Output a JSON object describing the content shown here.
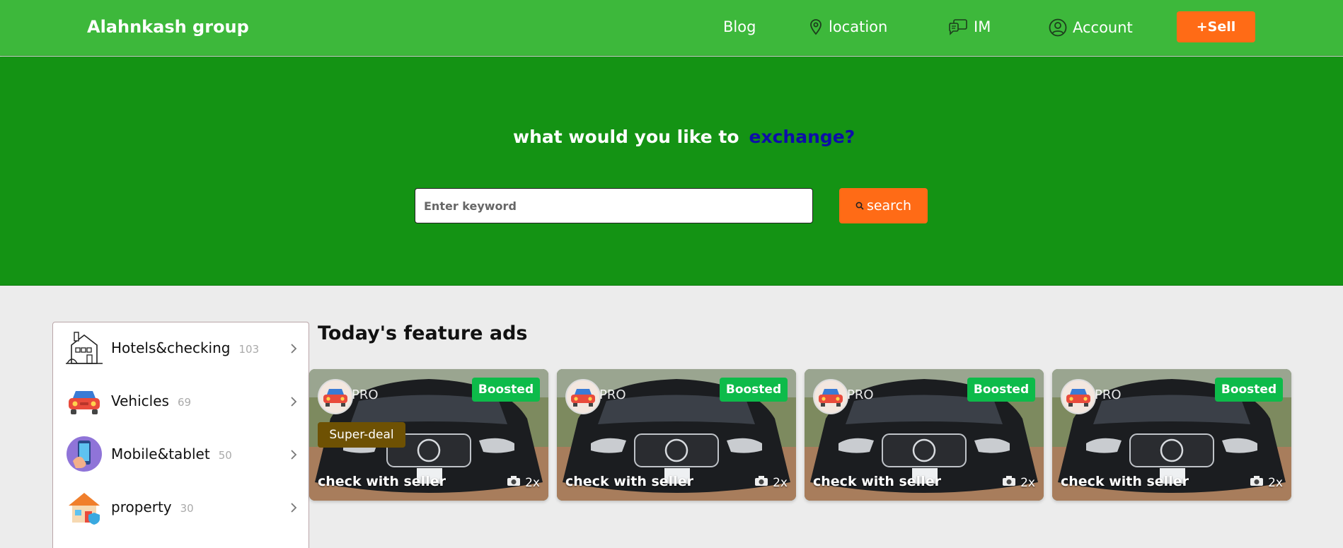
{
  "header": {
    "brand": "Alahnkash group",
    "nav": {
      "blog": "Blog",
      "location": "location",
      "im": "IM",
      "account": "Account"
    },
    "sell_label": "+Sell"
  },
  "hero": {
    "title_lead": "what would you like to",
    "title_accent": "exchange?",
    "search_placeholder": "Enter keyword",
    "search_value": "",
    "search_button": "search"
  },
  "categories": [
    {
      "name": "Hotels&checking",
      "count": "103",
      "icon": "hotel-icon"
    },
    {
      "name": "Vehicles",
      "count": "69",
      "icon": "car-icon"
    },
    {
      "name": "Mobile&tablet",
      "count": "50",
      "icon": "mobile-icon"
    },
    {
      "name": "property",
      "count": "30",
      "icon": "house-icon"
    }
  ],
  "feature_ads": {
    "title": "Today's feature ads",
    "ads": [
      {
        "badge": "Boosted",
        "tier": "PRO",
        "deal": "Super-deal",
        "title": "check with seller",
        "photos": "2x"
      },
      {
        "badge": "Boosted",
        "tier": "PRO",
        "deal": "",
        "title": "check with seller",
        "photos": "2x"
      },
      {
        "badge": "Boosted",
        "tier": "PRO",
        "deal": "",
        "title": "check with seller",
        "photos": "2x"
      },
      {
        "badge": "Boosted",
        "tier": "PRO",
        "deal": "",
        "title": "check with seller",
        "photos": "2x"
      }
    ]
  },
  "colors": {
    "topbar": "#3db83b",
    "hero": "#149314",
    "accent_orange": "#ff6b16",
    "accent_blue": "#0d0ea8",
    "boosted_green": "#0dbb4a"
  }
}
